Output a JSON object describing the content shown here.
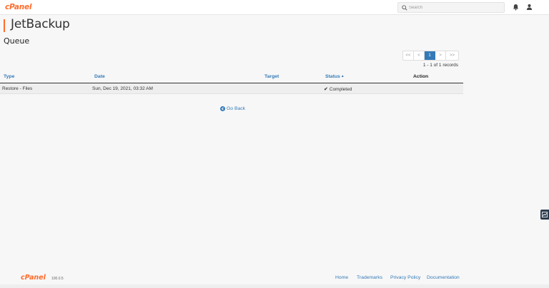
{
  "header": {
    "logo": "cPanel",
    "search_placeholder": "Search",
    "icons": [
      "search-icon",
      "bell-icon",
      "user-icon"
    ]
  },
  "app_title": "JetBackup",
  "page_title": "Queue",
  "pagination": {
    "first": "<<",
    "prev": "<",
    "current": "1",
    "next": ">",
    "last": ">>",
    "records": "1 - 1 of 1 records"
  },
  "table": {
    "columns": {
      "type": "Type",
      "date": "Date",
      "target": "Target",
      "status": "Status",
      "action": "Action"
    },
    "rows": [
      {
        "type": "Restore - Files",
        "date": "Sun, Dec 19, 2021, 03:32 AM",
        "target": "",
        "status": "Completed",
        "action": ""
      }
    ]
  },
  "go_back": "Go Back",
  "footer": {
    "logo": "cPanel",
    "version": "100.0.5",
    "links": {
      "home": "Home",
      "trademarks": "Trademarks",
      "privacy": "Privacy Policy",
      "docs": "Documentation"
    }
  },
  "colors": {
    "brand": "#ff6c2c",
    "link": "#337ab7",
    "active_page": "#337ab7"
  }
}
